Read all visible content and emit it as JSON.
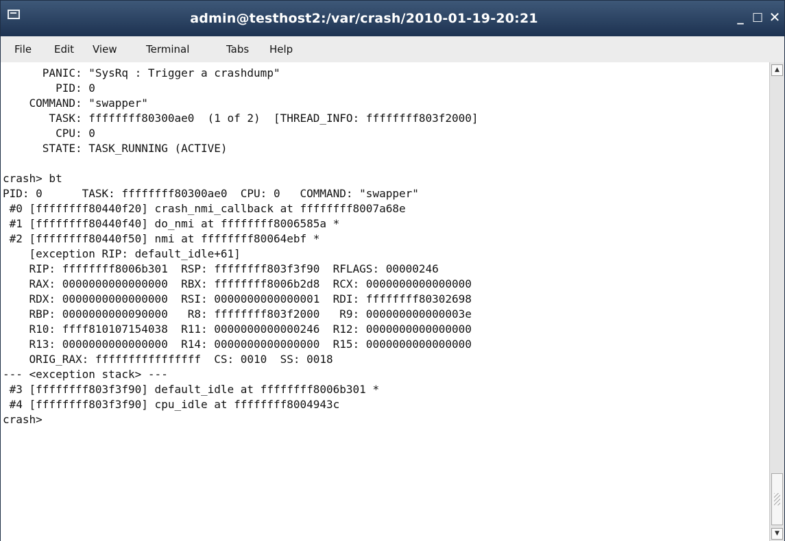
{
  "window": {
    "title": "admin@testhost2:/var/crash/2010-01-19-20:21"
  },
  "window_controls": {
    "minimize": "_",
    "maximize": "□",
    "close": "✕"
  },
  "menu": [
    {
      "label": "File"
    },
    {
      "label": "Edit"
    },
    {
      "label": "View"
    },
    {
      "label": "Terminal"
    },
    {
      "label": "Tabs"
    },
    {
      "label": "Help"
    }
  ],
  "terminal": {
    "lines": [
      "      PANIC: \"SysRq : Trigger a crashdump\"",
      "        PID: 0",
      "    COMMAND: \"swapper\"",
      "       TASK: ffffffff80300ae0  (1 of 2)  [THREAD_INFO: ffffffff803f2000]",
      "        CPU: 0",
      "      STATE: TASK_RUNNING (ACTIVE)",
      "",
      "crash> bt",
      "PID: 0      TASK: ffffffff80300ae0  CPU: 0   COMMAND: \"swapper\"",
      " #0 [ffffffff80440f20] crash_nmi_callback at ffffffff8007a68e",
      " #1 [ffffffff80440f40] do_nmi at ffffffff8006585a *",
      " #2 [ffffffff80440f50] nmi at ffffffff80064ebf *",
      "    [exception RIP: default_idle+61]",
      "    RIP: ffffffff8006b301  RSP: ffffffff803f3f90  RFLAGS: 00000246",
      "    RAX: 0000000000000000  RBX: ffffffff8006b2d8  RCX: 0000000000000000",
      "    RDX: 0000000000000000  RSI: 0000000000000001  RDI: ffffffff80302698",
      "    RBP: 0000000000090000   R8: ffffffff803f2000   R9: 000000000000003e",
      "    R10: ffff810107154038  R11: 0000000000000246  R12: 0000000000000000",
      "    R13: 0000000000000000  R14: 0000000000000000  R15: 0000000000000000",
      "    ORIG_RAX: ffffffffffffffff  CS: 0010  SS: 0018",
      "--- <exception stack> ---",
      " #3 [ffffffff803f3f90] default_idle at ffffffff8006b301 *",
      " #4 [ffffffff803f3f90] cpu_idle at ffffffff8004943c",
      "crash>"
    ]
  },
  "scrollbar": {
    "up_arrow": "▲",
    "down_arrow": "▼"
  }
}
